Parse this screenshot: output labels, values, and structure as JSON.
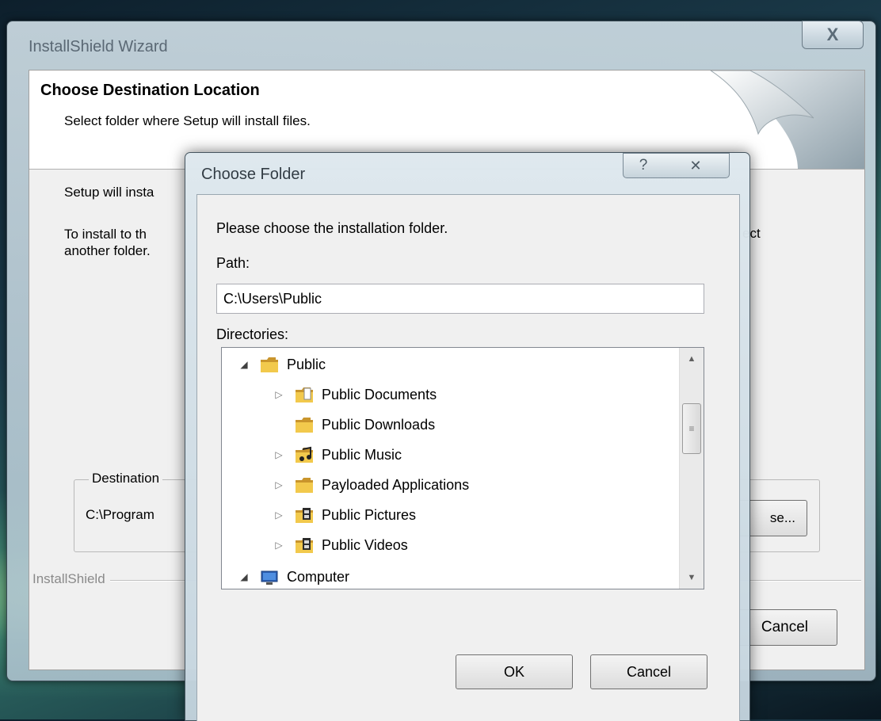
{
  "outer_window": {
    "title": "InstallShield Wizard",
    "close_glyph": "X",
    "heading": "Choose Destination Location",
    "subheading": "Select folder where Setup will install files.",
    "body_line1": "Setup will insta",
    "body_line2a": "To install to th",
    "body_line2b": "another folder.",
    "body_line2_tail": "ect",
    "destination_group_label": "Destination",
    "destination_path": "C:\\Program",
    "browse_label": "se...",
    "installshield_label": "InstallShield",
    "cancel_label": "Cancel"
  },
  "choose_folder": {
    "title": "Choose Folder",
    "help_glyph": "?",
    "close_glyph": "✕",
    "instruction": "Please choose the installation folder.",
    "path_label": "Path:",
    "path_value": "C:\\Users\\Public",
    "directories_label": "Directories:",
    "tree": [
      {
        "label": "Public",
        "expander": "expanded",
        "icon": "folder-icon"
      },
      {
        "label": "Public Documents",
        "expander": "collapsed",
        "icon": "documents-folder-icon"
      },
      {
        "label": "Public Downloads",
        "expander": "none",
        "icon": "folder-icon"
      },
      {
        "label": "Public Music",
        "expander": "collapsed",
        "icon": "music-folder-icon"
      },
      {
        "label": "Payloaded Applications",
        "expander": "collapsed",
        "icon": "folder-icon"
      },
      {
        "label": "Public Pictures",
        "expander": "collapsed",
        "icon": "pictures-folder-icon"
      },
      {
        "label": "Public Videos",
        "expander": "collapsed",
        "icon": "videos-folder-icon"
      },
      {
        "label": "Computer",
        "expander": "expanded",
        "icon": "computer-icon"
      }
    ],
    "ok_label": "OK",
    "cancel_label": "Cancel"
  },
  "colors": {
    "folder_yellow": "#f2c94c",
    "folder_dark": "#c9952c",
    "computer_blue": "#2a5db0"
  }
}
